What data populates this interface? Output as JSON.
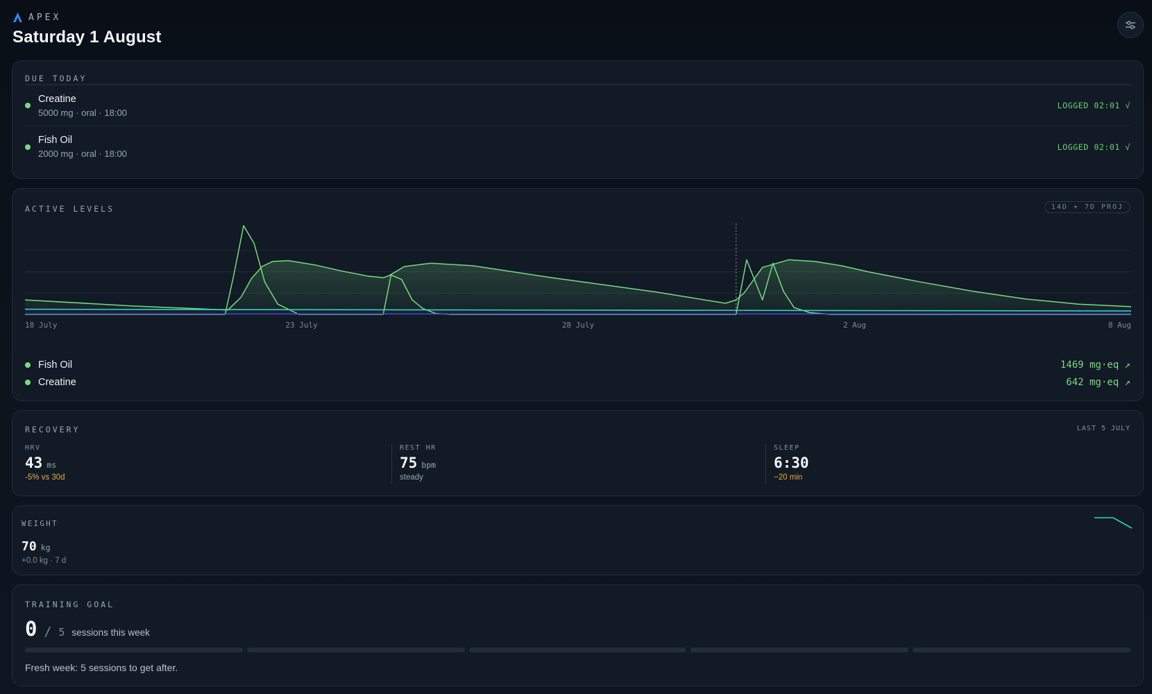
{
  "app": {
    "brand": "APEX",
    "date_title": "Saturday 1 August",
    "brand_color": "#3b82f6",
    "settings_icon": "sliders-icon"
  },
  "due_today": {
    "label": "DUE TODAY",
    "items": [
      {
        "name": "Creatine",
        "detail": "5000 mg · oral · 18:00",
        "status": "LOGGED 02:01 √",
        "status_color": "#6fcf7a"
      },
      {
        "name": "Fish Oil",
        "detail": "2000 mg · oral · 18:00",
        "status": "LOGGED 02:01 √",
        "status_color": "#6fcf7a"
      }
    ]
  },
  "active_levels": {
    "label": "ACTIVE LEVELS",
    "projection_pill": "14D + 7D PROJ",
    "legend": [
      {
        "name": "Fish Oil",
        "value": "1469 mg·eq ↗",
        "color": "#7bd884"
      },
      {
        "name": "Creatine",
        "value": "642 mg·eq ↗",
        "color": "#7bd884"
      }
    ]
  },
  "chart_data": {
    "type": "area",
    "x_ticks": [
      "18 July",
      "23 July",
      "28 July",
      "2 Aug",
      "8 Aug"
    ],
    "x_range_days": [
      0,
      21
    ],
    "y_range": [
      0,
      100
    ],
    "today_marker_day": 13.5,
    "grid": true,
    "series": [
      {
        "kind": "broad",
        "color": "#7bd884",
        "x": [
          0,
          2,
          3.5,
          3.85,
          4.1,
          4.3,
          4.5,
          4.7,
          5,
          5.5,
          6,
          6.5,
          6.8,
          6.9,
          7.2,
          7.7,
          8.5,
          10,
          12,
          13.3,
          13.5,
          13.65,
          14,
          14.5,
          15,
          15.5,
          16,
          17,
          18,
          19,
          20,
          21
        ],
        "y": [
          17,
          10,
          6,
          5,
          20,
          42,
          56,
          62,
          63,
          58,
          51,
          45,
          43,
          45,
          56,
          60,
          57,
          43,
          26,
          13,
          17,
          25,
          55,
          64,
          62,
          57,
          50,
          38,
          27,
          18,
          12,
          9
        ]
      },
      {
        "kind": "spikes",
        "color": "#7bd884",
        "x": [
          0,
          3.8,
          3.96,
          4.15,
          4.35,
          4.55,
          4.8,
          5.2,
          6.7,
          6.8,
          6.95,
          7.15,
          7.35,
          7.55,
          7.8,
          8.1,
          13.0,
          13.5,
          13.7,
          14.0,
          14.2,
          14.4,
          14.6,
          14.9,
          15.3,
          21
        ],
        "y": [
          0,
          0,
          45,
          104,
          83,
          38,
          12,
          0,
          0,
          0,
          46,
          41,
          17,
          7,
          1,
          0,
          0,
          0,
          64,
          17,
          60,
          27,
          8,
          2,
          0,
          0
        ]
      },
      {
        "kind": "baseline",
        "color": "#2dd4bf",
        "x": [
          0,
          21
        ],
        "y": [
          6,
          4
        ]
      },
      {
        "kind": "floor",
        "color": "#4f46e5",
        "x": [
          0,
          21
        ],
        "y": [
          0.5,
          0.5
        ]
      }
    ]
  },
  "recovery": {
    "label": "RECOVERY",
    "last_label": "LAST 5 JULY",
    "metrics": [
      {
        "label": "HRV",
        "value": "43",
        "unit": "ms",
        "sub": "-5% vs 30d",
        "sub_kind": "warn"
      },
      {
        "label": "REST HR",
        "value": "75",
        "unit": "bpm",
        "sub": "steady",
        "sub_kind": "muted"
      },
      {
        "label": "SLEEP",
        "value": "6:30",
        "unit": "",
        "sub": "−20 min",
        "sub_kind": "warn"
      }
    ]
  },
  "weight": {
    "label": "WEIGHT",
    "value": "70",
    "unit": "kg",
    "sub": "+0.0 kg · 7 d",
    "trend": [
      70,
      70,
      70,
      69.95,
      69.9
    ],
    "trend_color": "#2dd4bf"
  },
  "training": {
    "label": "TRAINING GOAL",
    "done": "0",
    "slash": "/",
    "target": "5",
    "suffix": "sessions this week",
    "segments_done": 0,
    "segments_total": 5,
    "note": "Fresh week: 5 sessions to get after."
  }
}
